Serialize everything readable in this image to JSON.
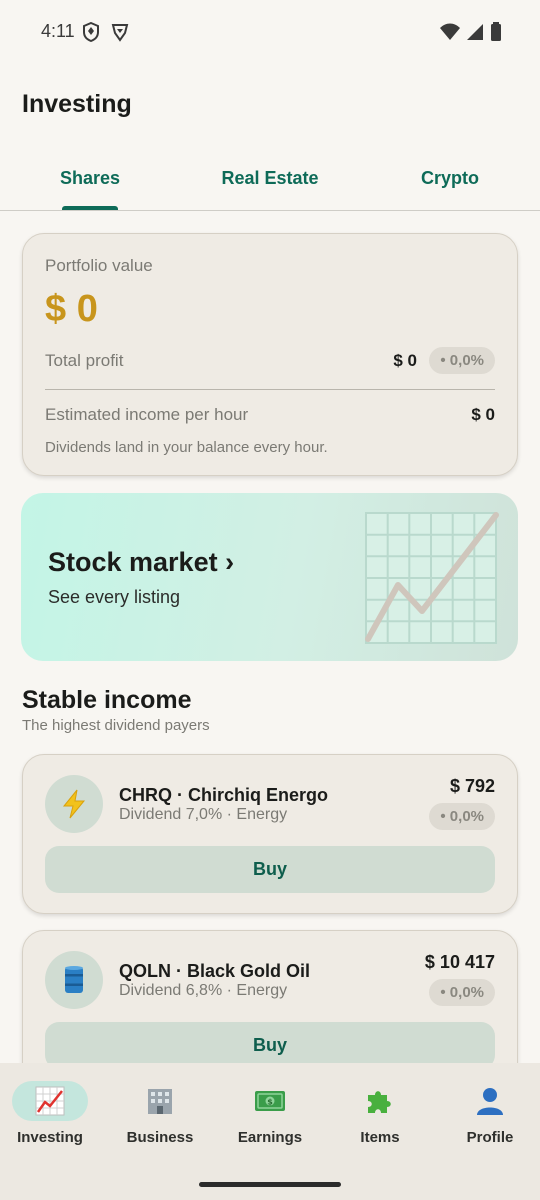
{
  "status_bar": {
    "time": "4:11"
  },
  "page": {
    "title": "Investing"
  },
  "tabs": [
    {
      "label": "Shares",
      "active": true
    },
    {
      "label": "Real Estate",
      "active": false
    },
    {
      "label": "Crypto",
      "active": false
    }
  ],
  "portfolio": {
    "label": "Portfolio value",
    "value": "$ 0",
    "total_profit_label": "Total profit",
    "total_profit_value": "$ 0",
    "total_profit_change": "• 0,0%",
    "income_label": "Estimated income per hour",
    "income_value": "$ 0",
    "note": "Dividends land in your balance every hour."
  },
  "market_banner": {
    "title": "Stock market ›",
    "subtitle": "See every listing"
  },
  "section": {
    "title": "Stable income",
    "subtitle": "The highest dividend payers"
  },
  "stocks": [
    {
      "name": "CHRQ · Chirchiq Energo",
      "meta": "Dividend 7,0% · Energy",
      "price": "$ 792",
      "change": "• 0,0%",
      "icon": "lightning-icon",
      "buy_label": "Buy"
    },
    {
      "name": "QOLN · Black Gold Oil",
      "meta": "Dividend 6,8% · Energy",
      "price": "$ 10 417",
      "change": "• 0,0%",
      "icon": "oil-barrel-icon",
      "buy_label": "Buy"
    }
  ],
  "bottom_nav": [
    {
      "label": "Investing",
      "icon": "chart-up-icon",
      "active": true
    },
    {
      "label": "Business",
      "icon": "office-building-icon",
      "active": false
    },
    {
      "label": "Earnings",
      "icon": "money-icon",
      "active": false
    },
    {
      "label": "Items",
      "icon": "puzzle-icon",
      "active": false
    },
    {
      "label": "Profile",
      "icon": "person-icon",
      "active": false
    }
  ],
  "colors": {
    "accent": "#0e6b58",
    "gold": "#c8951c",
    "background": "#f8f6f2",
    "card": "#efebe4"
  }
}
